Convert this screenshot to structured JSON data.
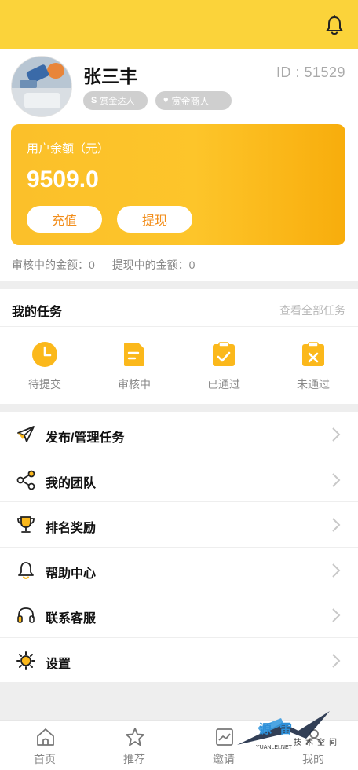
{
  "header": {
    "bg_color": "#fbd33a",
    "icon": "bell-icon"
  },
  "profile": {
    "name": "张三丰",
    "id_text": "ID : 51529",
    "badges": [
      {
        "icon": "s-badge-icon",
        "label": "赏金达人"
      },
      {
        "icon": "heart-icon",
        "label": "赏金商人"
      }
    ]
  },
  "balance": {
    "label": "用户余额（元）",
    "value": "9509.0",
    "recharge_label": "充值",
    "withdraw_label": "提现",
    "card_color": "#fdc52a"
  },
  "pending": {
    "reviewing": "审核中的金额：0",
    "withdrawing": "提现中的金额：0"
  },
  "tasks": {
    "title": "我的任务",
    "view_all": "查看全部任务",
    "items": [
      {
        "icon": "clock-icon",
        "label": "待提交"
      },
      {
        "icon": "document-icon",
        "label": "审核中"
      },
      {
        "icon": "clipboard-check-icon",
        "label": "已通过"
      },
      {
        "icon": "clipboard-x-icon",
        "label": "未通过"
      }
    ]
  },
  "menu": [
    {
      "icon": "paper-plane-icon",
      "label": "发布/管理任务"
    },
    {
      "icon": "share-nodes-icon",
      "label": "我的团队"
    },
    {
      "icon": "trophy-icon",
      "label": "排名奖励"
    },
    {
      "icon": "help-bell-icon",
      "label": "帮助中心"
    },
    {
      "icon": "headset-icon",
      "label": "联系客服"
    },
    {
      "icon": "gear-icon",
      "label": "设置"
    }
  ],
  "tabbar": [
    {
      "icon": "home-icon",
      "label": "首页"
    },
    {
      "icon": "star-icon",
      "label": "推荐"
    },
    {
      "icon": "chart-icon",
      "label": "邀请"
    },
    {
      "icon": "user-icon",
      "label": "我的"
    }
  ],
  "watermark": {
    "main": "源雷",
    "sub": "技术空间",
    "url": "YUANLEI.NET"
  },
  "accent_color": "#fbc02a",
  "button_text_color": "#f28d1a"
}
